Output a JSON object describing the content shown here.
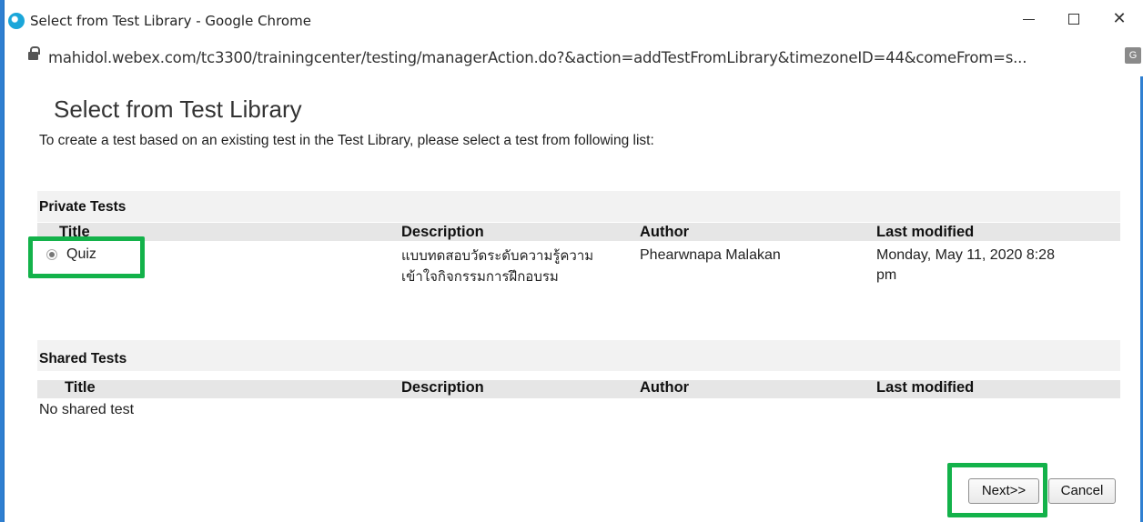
{
  "window": {
    "title": "Select from Test Library - Google Chrome",
    "minimize_label": "—",
    "maximize_label": "☐",
    "close_label": "✕"
  },
  "address_bar": {
    "url": "mahidol.webex.com/tc3300/trainingcenter/testing/managerAction.do?&action=addTestFromLibrary&timezoneID=44&comeFrom=s..."
  },
  "page": {
    "title": "Select from Test Library",
    "instructions": "To create a test based on an existing test in the Test Library, please select a test from following list:"
  },
  "private_tests": {
    "section_title": "Private Tests",
    "columns": [
      "Title",
      "Description",
      "Author",
      "Last modified"
    ],
    "rows": [
      {
        "title": "Quiz",
        "description_line1": "แบบทดสอบวัดระดับความรู้ความ",
        "description_line2": "เข้าใจกิจกรรมการฝึกอบรม",
        "author": "Phearwnapa Malakan",
        "modified_line1": "Monday, May 11, 2020 8:28",
        "modified_line2": "pm",
        "selected": true
      }
    ]
  },
  "shared_tests": {
    "section_title": "Shared Tests",
    "columns": [
      "Title",
      "Description",
      "Author",
      "Last modified"
    ],
    "empty_message": "No shared test"
  },
  "buttons": {
    "next_label": "Next>>",
    "cancel_label": "Cancel"
  },
  "colors": {
    "highlight": "#13b24a",
    "frame": "#2f7fd1"
  }
}
